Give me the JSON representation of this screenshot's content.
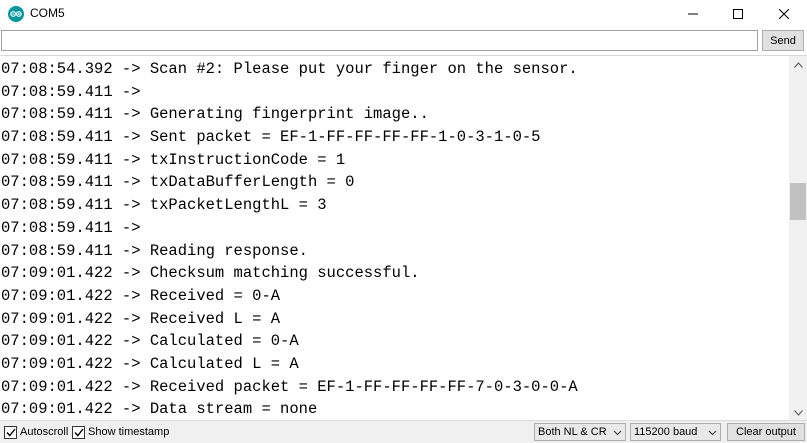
{
  "window": {
    "title": "COM5",
    "app_icon": "arduino-logo-icon",
    "controls": [
      "minimize-icon",
      "maximize-icon",
      "close-icon"
    ]
  },
  "input": {
    "value": "",
    "send_label": "Send"
  },
  "console": {
    "lines": [
      "07:08:54.392 -> Scan #2: Please put your finger on the sensor.",
      "07:08:59.411 -> ",
      "07:08:59.411 -> Generating fingerprint image..",
      "07:08:59.411 -> Sent packet = EF-1-FF-FF-FF-FF-1-0-3-1-0-5",
      "07:08:59.411 -> txInstructionCode = 1",
      "07:08:59.411 -> txDataBufferLength = 0",
      "07:08:59.411 -> txPacketLengthL = 3",
      "07:08:59.411 -> ",
      "07:08:59.411 -> Reading response.",
      "07:09:01.422 -> Checksum matching successful.",
      "07:09:01.422 -> Received = 0-A",
      "07:09:01.422 -> Received L = A",
      "07:09:01.422 -> Calculated = 0-A",
      "07:09:01.422 -> Calculated L = A",
      "07:09:01.422 -> Received packet = EF-1-FF-FF-FF-FF-7-0-3-0-0-A",
      "07:09:01.422 -> Data stream = none"
    ]
  },
  "statusbar": {
    "autoscroll_label": "Autoscroll",
    "autoscroll_checked": true,
    "timestamp_label": "Show timestamp",
    "timestamp_checked": true,
    "line_ending": "Both NL & CR",
    "baud": "115200 baud",
    "clear_label": "Clear output"
  },
  "colors": {
    "accent": "#00979c",
    "scrollbar_track": "#f0f0f0",
    "scrollbar_thumb": "#c1c1c1"
  }
}
